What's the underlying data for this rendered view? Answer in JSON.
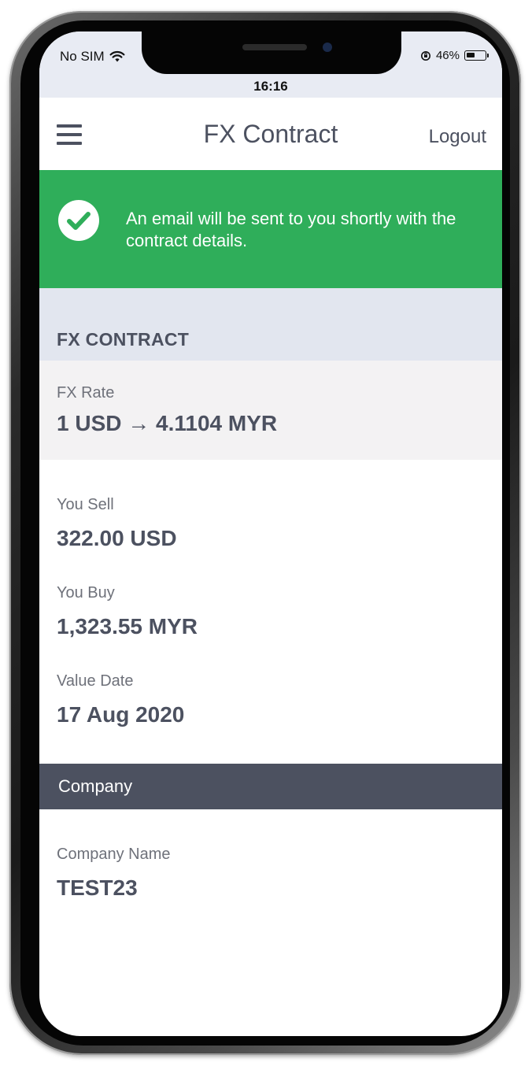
{
  "status_bar": {
    "carrier": "No SIM",
    "time": "16:16",
    "battery_percent": "46%",
    "icons": [
      "wifi-icon",
      "orientation-lock-icon",
      "battery-icon"
    ]
  },
  "navbar": {
    "menu_icon": "hamburger-menu-icon",
    "title": "FX Contract",
    "logout_label": "Logout"
  },
  "alert": {
    "icon": "check-circle-icon",
    "message": "An email will be sent to you shortly with the contract details.",
    "color": "#2fae5a"
  },
  "contract_section": {
    "title": "FX CONTRACT",
    "rate_label": "FX Rate",
    "rate_value": "1 USD → 4.1104 MYR",
    "sell_label": "You Sell",
    "sell_value": "322.00 USD",
    "buy_label": "You Buy",
    "buy_value": "1,323.55 MYR",
    "value_date_label": "Value Date",
    "value_date": "17 Aug 2020"
  },
  "company_section": {
    "title": "Company",
    "name_label": "Company Name",
    "name_value": "TEST23"
  },
  "colors": {
    "text_primary": "#4c5160",
    "section_bg": "#e2e6ef",
    "company_header_bg": "#4c5160"
  }
}
